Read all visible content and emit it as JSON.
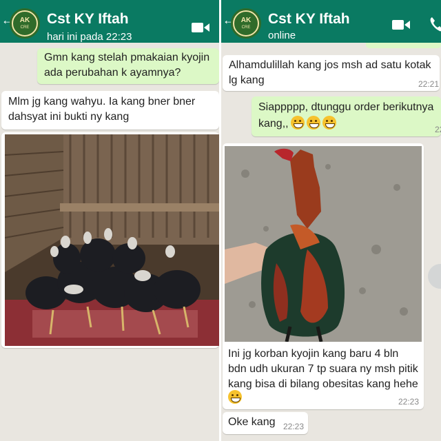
{
  "left_panel": {
    "header": {
      "contact_name": "Cst KY Iftah",
      "status": "hari ini pada 22:23"
    },
    "messages": {
      "m1": "Gmn kang stelah pmakaian kyojin\nada perubahan k ayamnya?",
      "m2": "Mlm jg kang wahyu. Ia kang bner bner\ndahsyat ini bukti ny kang"
    }
  },
  "right_panel": {
    "header": {
      "contact_name": "Cst KY Iftah",
      "status": "online"
    },
    "messages": {
      "m1": "Alhamdulillah kang jos msh ad satu kotak\nlg kang",
      "m1_time": "22:21",
      "m2": "Siappppp,  dtunggu order berikutnya\nkang,,",
      "m2_time": "22",
      "m3": "Ini jg korban kyojin kang baru 4 bln\nbdn udh ukuran 7 tp suara ny msh pitik\nkang bisa di bilang obesitas kang hehe",
      "m3_time": "22:23",
      "m4": "Oke kang",
      "m4_time": "22:23"
    }
  },
  "avatar_logo_text": [
    "AK",
    "CRE"
  ],
  "colors": {
    "header": "#0a7a62",
    "chat_background": "#e9e6e0",
    "incoming_bubble": "#ffffff",
    "outgoing_bubble": "#dcf8c6",
    "emoji": "#f6c22d"
  },
  "icons": [
    "back-arrow-icon",
    "video-call-icon",
    "voice-call-icon",
    "grinning-emoji-icon",
    "scroll-down-icon"
  ]
}
